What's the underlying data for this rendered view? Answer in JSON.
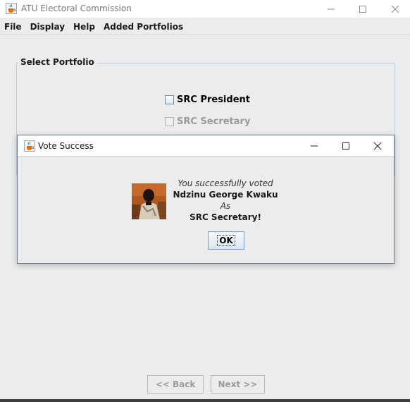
{
  "app": {
    "title": "ATU Electoral Commission",
    "icon": "java-cup-icon"
  },
  "menu": {
    "items": [
      "File",
      "Display",
      "Help",
      "Added Portfolios"
    ]
  },
  "portfolio_panel": {
    "title": "Select Portfolio",
    "options": [
      {
        "label": "SRC President",
        "checked": false,
        "enabled": true
      },
      {
        "label": "SRC Secretary",
        "checked": false,
        "enabled": false
      }
    ]
  },
  "navigation": {
    "back_label": "<< Back",
    "next_label": "Next >>"
  },
  "dialog": {
    "title": "Vote Success",
    "line1": "You successfully voted",
    "candidate": "Ndzinu George Kwaku",
    "as_label": "As",
    "portfolio": "SRC Secretary!",
    "ok_label": "OK",
    "photo": "candidate-photo"
  },
  "colors": {
    "window_bg": "#ececec",
    "panel_border": "#b8cfe5",
    "ok_border": "#7a9cc8"
  }
}
